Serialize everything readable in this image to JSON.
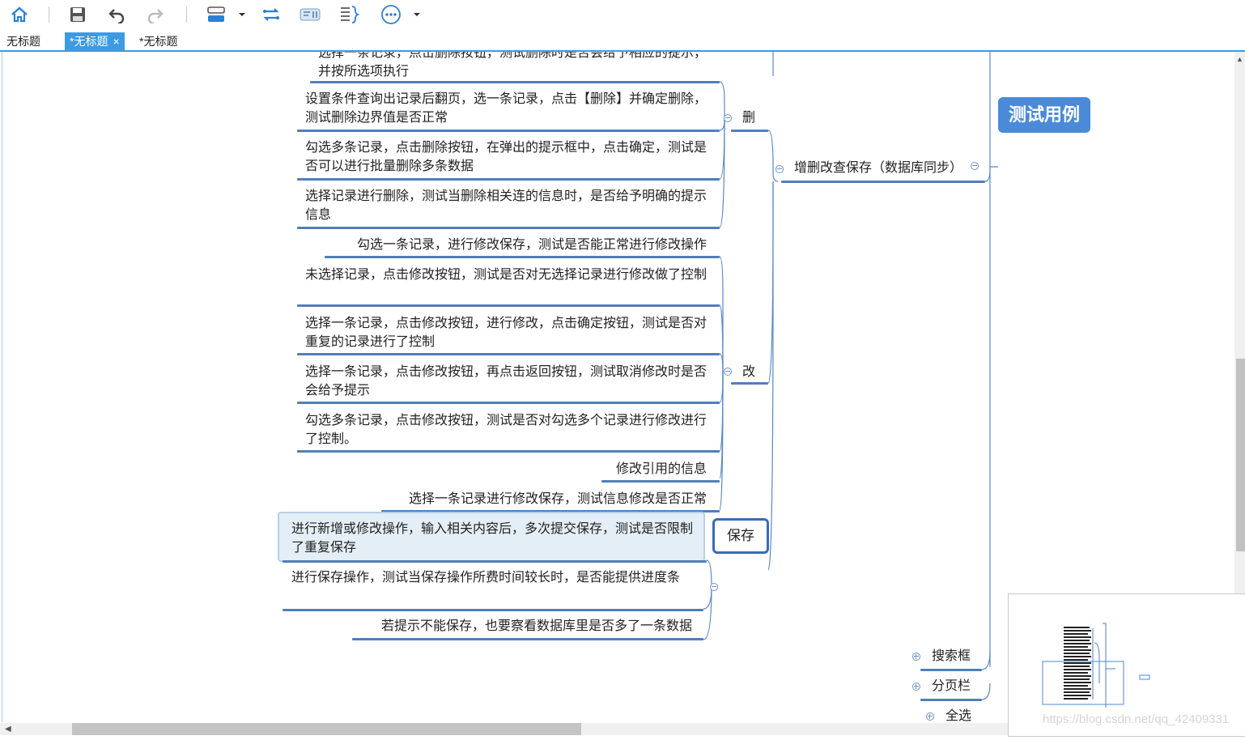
{
  "toolbar": {
    "icons": [
      "home-icon",
      "save-icon",
      "undo-icon",
      "redo-icon",
      "layout-icon",
      "dropdown-icon",
      "link-icon",
      "summary-icon",
      "brace-icon",
      "more-icon",
      "dropdown-icon"
    ]
  },
  "tabs": [
    {
      "label": "无标题"
    },
    {
      "label": "*无标题",
      "close": "×"
    },
    {
      "label": "*无标题"
    }
  ],
  "colors": {
    "accent": "#3c9be2",
    "root": "#4a8ad9",
    "line": "#4f7fba"
  },
  "mindmap": {
    "root": "测试用例",
    "branch": "增删改查保存（数据库同步）",
    "groups": {
      "delete": "删",
      "modify": "改",
      "save": "保存"
    },
    "delete_items": [
      "选择一条记录，点击删除按钮，测试删除时是否会给予相应的提示，并按所选项执行",
      "设置条件查询出记录后翻页，选一条记录，点击【删除】并确定删除，测试删除边界值是否正常",
      "勾选多条记录，点击删除按钮，在弹出的提示框中，点击确定，测试是否可以进行批量删除多条数据",
      "选择记录进行删除，测试当删除相关连的信息时，是否给予明确的提示信息"
    ],
    "modify_items": [
      "勾选一条记录，进行修改保存，测试是否能正常进行修改操作",
      "未选择记录，点击修改按钮，测试是否对无选择记录进行修改做了控制",
      "选择一条记录，点击修改按钮，进行修改，点击确定按钮，测试是否对重复的记录进行了控制",
      "选择一条记录，点击修改按钮，再点击返回按钮，测试取消修改时是否会给予提示",
      "勾选多条记录，点击修改按钮，测试是否对勾选多个记录进行修改进行了控制。",
      "修改引用的信息",
      "选择一条记录进行修改保存，测试信息修改是否正常"
    ],
    "save_items": [
      "进行新增或修改操作，输入相关内容后，多次提交保存，测试是否限制了重复保存",
      "进行保存操作，测试当保存操作所费时间较长时，是否能提供进度条",
      "若提示不能保存，也要察看数据库里是否多了一条数据"
    ],
    "other_branches": [
      "搜索框",
      "分页栏",
      "全选"
    ]
  },
  "watermark": "https://blog.csdn.net/qq_42409331"
}
